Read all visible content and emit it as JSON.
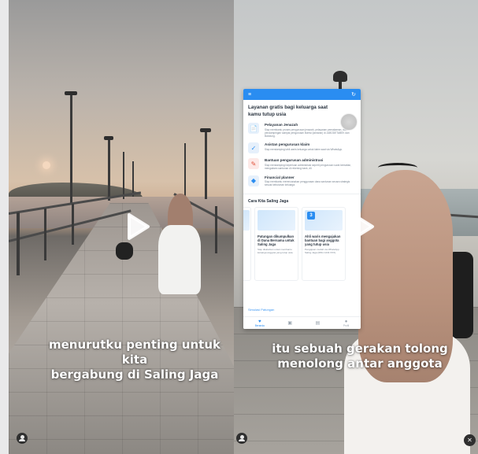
{
  "left_video": {
    "caption_line1": "menurutku penting untuk kita",
    "caption_line2": "bergabung di Saling Jaga",
    "play_icon": "play-icon",
    "user_icon": "user-avatar-icon"
  },
  "right_video": {
    "caption_line1": "itu sebuah gerakan tolong",
    "caption_line2": "menolong antar anggota",
    "play_icon": "play-icon",
    "user_icon": "user-avatar-icon",
    "mute_icon": "mute-icon"
  },
  "app": {
    "header_left_icon": "≡",
    "header_right_icon": "↻",
    "title": "Layanan gratis bagi keluarga saat kamu tutup usia",
    "services": [
      {
        "icon": "📄",
        "tone": "blue",
        "name": "Pelayanan Jenazah",
        "desc": "Siap membantu proses pengurusan jenazah, pelayanan pemakaman, dan pendampingan sampai pengurusan lisensi (lamaran) di JABODETABEK dan Bandung."
      },
      {
        "icon": "✓",
        "tone": "blue",
        "name": "Asistan pengurusan klaim",
        "desc": "Siap mendampingi ahli waris keluarga untuk klaim saat via WhatsApp."
      },
      {
        "icon": "✎",
        "tone": "red",
        "name": "Bantuan pengurusan administrasi",
        "desc": "Siap mendampingi keperluan administrasi seperti pengurusan surat kematian, mengakses santunan di rekening bank, dll."
      },
      {
        "icon": "◆",
        "tone": "blue",
        "name": "Financial planner",
        "desc": "Siap membantu merencanakan penggunaan dana santunan secara strategis sesuai kebutuhan keluarga."
      }
    ],
    "cara_title": "Cara Kita Saling Jaga",
    "cards": [
      {
        "num": "",
        "title": "Patungan dikumpulkan di Dana Bersama untuk Saling Jaga",
        "desc": "Siap disalurkan untuk membantu keluarga anggota yang tutup usia."
      },
      {
        "num": "3",
        "title": "Ahli waris mengajukan bantuan bagi anggota yang tutup usia",
        "desc": "Pengajuan mudah via WhatsApp Saling Jaga (0811 1234 XXX)."
      }
    ],
    "simulasi_text": "Simulasi Patungan",
    "nav": [
      {
        "icon": "♥",
        "label": "Beranda",
        "active": true
      },
      {
        "icon": "▣",
        "label": "",
        "active": false
      },
      {
        "icon": "▤",
        "label": "",
        "active": false
      },
      {
        "icon": "●",
        "label": "Profil",
        "active": false
      }
    ],
    "accent_color": "#2a8df1"
  }
}
